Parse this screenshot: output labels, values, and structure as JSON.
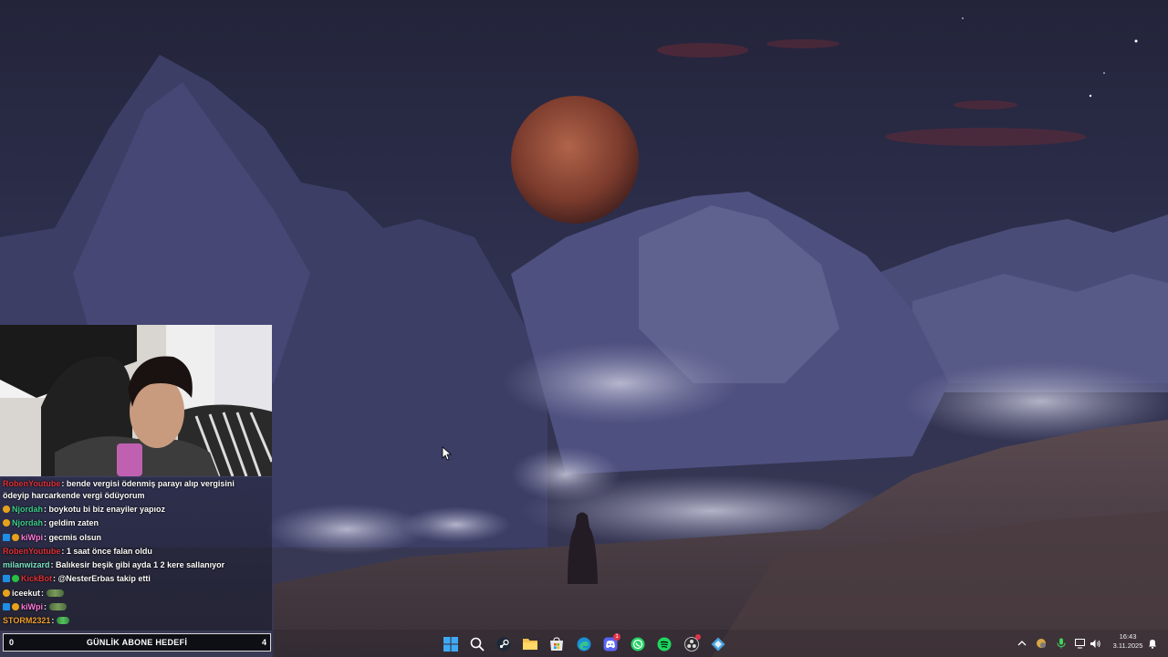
{
  "chat": {
    "messages": [
      {
        "user": "RobenYoutube",
        "text": ": bende vergisi ödenmiş parayı alıp vergisini ödeyip harcarkende vergi ödüyorum",
        "color": "#e0323a",
        "badges": []
      },
      {
        "user": "Njordah",
        "text": ": boykotu bi biz enayiler yapıoz",
        "color": "#3ecf8e",
        "badges": [
          "sub"
        ]
      },
      {
        "user": "Njordah",
        "text": ": geldim zaten",
        "color": "#3ecf8e",
        "badges": [
          "sub"
        ]
      },
      {
        "user": "kiWpi",
        "text": ": gecmis olsun",
        "color": "#ff7ad9",
        "badges": [
          "blue",
          "sub"
        ]
      },
      {
        "user": "RobenYoutube",
        "text": ": 1 saat önce falan oldu",
        "color": "#e0323a",
        "badges": []
      },
      {
        "user": "milanwizard",
        "text": ": Balıkesir beşik gibi ayda 1 2 kere sallanıyor",
        "color": "#7ee6c8",
        "badges": []
      },
      {
        "user": "KickBot",
        "text": ": @NesterErbas takip etti",
        "color": "#e0323a",
        "badges": [
          "blue",
          "green"
        ]
      },
      {
        "user": "iceekut",
        "text": ":",
        "color": "#ffffff",
        "badges": [
          "sub"
        ],
        "emote": true
      },
      {
        "user": "kiWpi",
        "text": ":",
        "color": "#ff7ad9",
        "badges": [
          "blue",
          "sub"
        ],
        "emote": true
      },
      {
        "user": "STORM2321",
        "text": ":",
        "color": "#f0a030",
        "badges": [],
        "emote": true
      }
    ]
  },
  "goal": {
    "label": "GÜNLİK ABONE HEDEFİ",
    "current": "0",
    "target": "4"
  },
  "taskbar": {
    "apps": [
      "windows-start",
      "search",
      "steam",
      "file-explorer",
      "microsoft-store",
      "edge",
      "discord",
      "whatsapp",
      "spotify",
      "obs",
      "app"
    ],
    "discord_badge": "1"
  },
  "clock": {
    "time": "16:43",
    "date": "3.11.2025"
  }
}
